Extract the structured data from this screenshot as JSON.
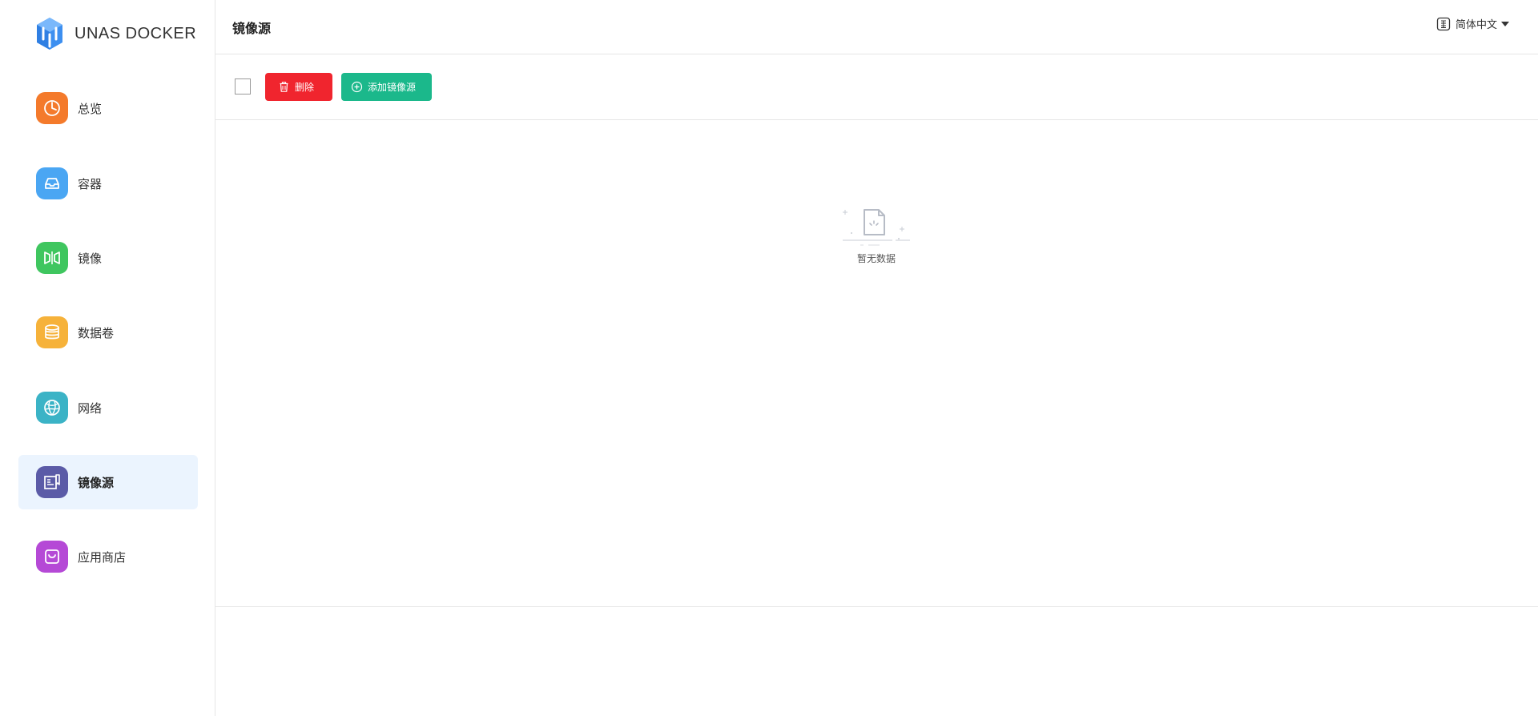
{
  "app": {
    "brand": "UNAS DOCKER"
  },
  "sidebar": {
    "items": [
      {
        "label": "总览",
        "icon": "dashboard-icon",
        "color": "#f47a2b"
      },
      {
        "label": "容器",
        "icon": "inbox-icon",
        "color": "#4aa6f3"
      },
      {
        "label": "镜像",
        "icon": "mirror-icon",
        "color": "#3fc65f"
      },
      {
        "label": "数据卷",
        "icon": "database-icon",
        "color": "#f6b23a"
      },
      {
        "label": "网络",
        "icon": "globe-icon",
        "color": "#3bb3c6"
      },
      {
        "label": "镜像源",
        "icon": "registry-icon",
        "color": "#5b5ba7",
        "active": true
      },
      {
        "label": "应用商店",
        "icon": "store-bag-icon",
        "color": "#b549d6"
      }
    ]
  },
  "header": {
    "title": "镜像源",
    "language": "简体中文"
  },
  "toolbar": {
    "delete_label": "删除",
    "add_label": "添加镜像源",
    "delete_color": "#f0252e",
    "add_color": "#1bb88b"
  },
  "content": {
    "empty_text": "暂无数据"
  }
}
